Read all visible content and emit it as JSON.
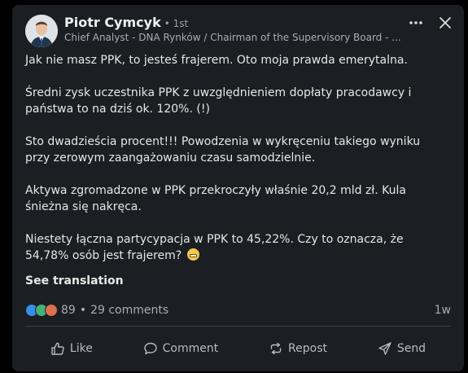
{
  "post": {
    "author": {
      "name": "Piotr Cymcyk",
      "degree": "• 1st",
      "headline": "Chief Analyst - DNA Rynków / Chairman of the Supervisory Board - ..."
    },
    "paragraphs": [
      "Jak nie masz PPK, to jesteś frajerem. Oto moja prawda emerytalna.",
      "Średni zysk uczestnika PPK z uwzględnieniem dopłaty pracodawcy i państwa to na dziś ok. 120%. (!)",
      "Sto dwadzieścia procent!!! Powodzenia w wykręceniu takiego wyniku przy zerowym zaangażowaniu czasu samodzielnie.",
      "Aktywa zgromadzone w PPK przekroczyły właśnie 20,2 mld zł. Kula śnieżna się nakręca.",
      "Niestety łączna partycypacja w PPK to 45,22%. Czy to oznacza, że 54,78% osób jest frajerem?"
    ],
    "see_translation": "See translation",
    "reactions_count": "89",
    "separator": "•",
    "comments": "29 comments",
    "time": "1w",
    "reaction_icons": [
      "like-icon",
      "celebrate-icon",
      "love-icon"
    ],
    "last_paragraph_emoji": "grimacing-face-icon"
  },
  "actions": [
    {
      "label": "Like",
      "icon": "thumbs-up-icon"
    },
    {
      "label": "Comment",
      "icon": "comment-icon"
    },
    {
      "label": "Repost",
      "icon": "repost-icon"
    },
    {
      "label": "Send",
      "icon": "send-icon"
    }
  ],
  "header_controls": {
    "more": "more-icon",
    "close": "close-icon"
  },
  "colors": {
    "card_bg": "#1b1f23",
    "page_bg": "#000000",
    "text": "#e9e9e9",
    "muted": "#a8adb3",
    "like_blue": "#378fe9",
    "celebrate_green": "#44b37a",
    "love_red": "#df704d"
  }
}
